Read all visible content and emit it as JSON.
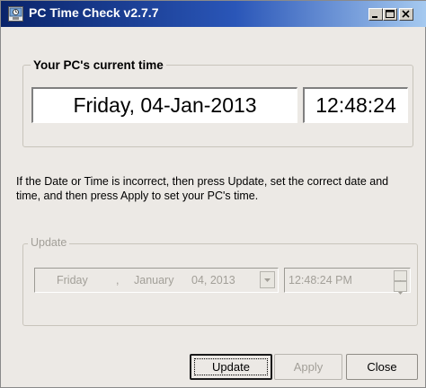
{
  "window": {
    "title": "PC Time Check  v2.7.7",
    "controls": {
      "minimize": "minimize-icon",
      "maximize": "maximize-icon",
      "close": "close-icon"
    }
  },
  "current_time": {
    "legend": "Your PC's current time",
    "date": "Friday, 04-Jan-2013",
    "time": "12:48:24"
  },
  "info_text": "If the Date or Time is incorrect, then press Update, set the correct date and time, and then press Apply to set your PC's time.",
  "update_group": {
    "legend": "Update",
    "date_picker": {
      "day_name": "Friday",
      "separator": ",",
      "month": "January",
      "day_year": "04, 2013"
    },
    "time_picker": "12:48:24 PM"
  },
  "buttons": {
    "update": "Update",
    "apply": "Apply",
    "close": "Close"
  }
}
